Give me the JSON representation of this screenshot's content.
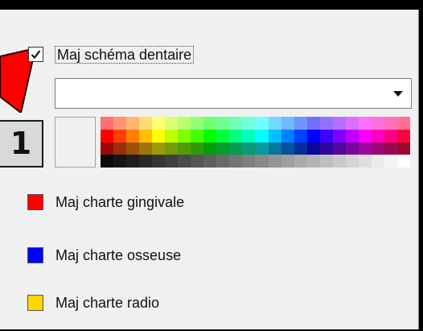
{
  "step_number": "1",
  "schema_option": {
    "label": "Maj schéma dentaire",
    "checked": true
  },
  "combo": {
    "value": "",
    "arrow_icon": "triangle-down-icon"
  },
  "legend": [
    {
      "label": "Maj charte gingivale",
      "color": "#ff0000"
    },
    {
      "label": "Maj charte osseuse",
      "color": "#0000ff"
    },
    {
      "label": "Maj charte radio",
      "color": "#ffd700"
    }
  ],
  "accent": "#ff0000"
}
